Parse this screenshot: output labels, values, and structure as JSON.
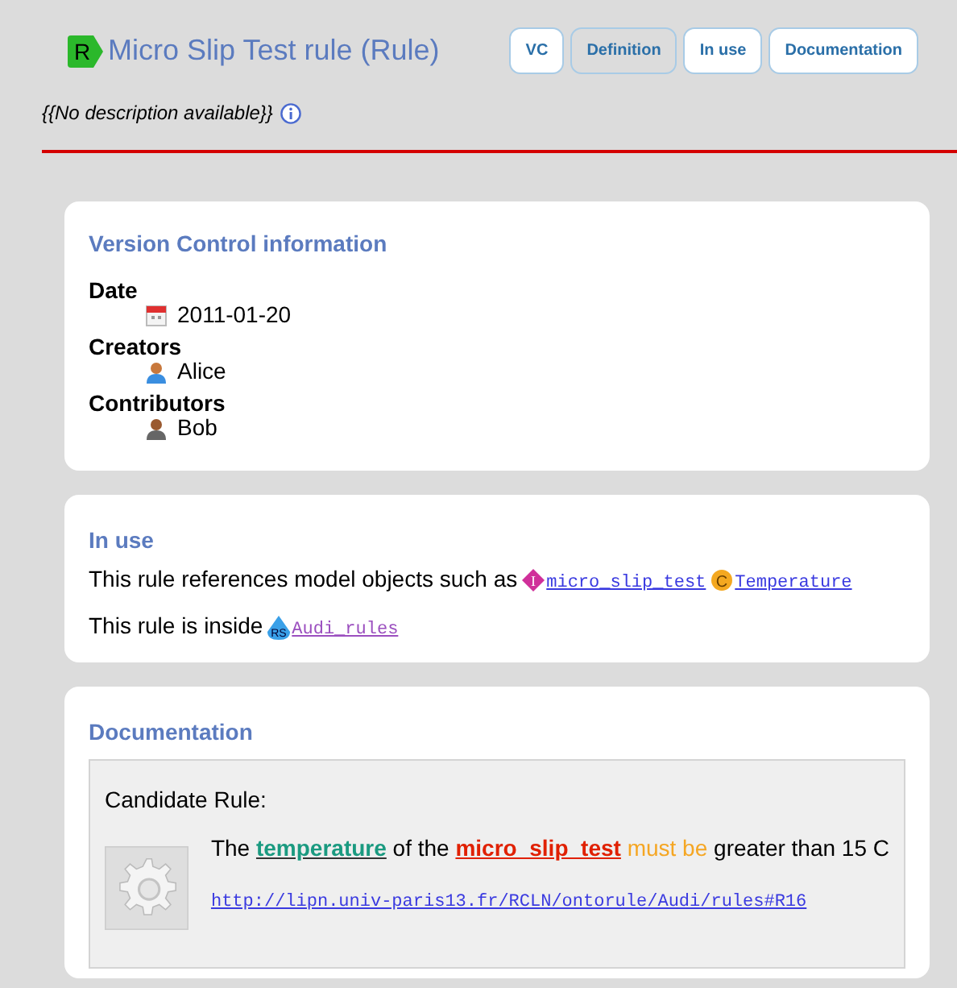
{
  "header": {
    "logo_letter": "R",
    "title": "Micro Slip Test rule (Rule)",
    "description": "{{No description available}}",
    "tabs": [
      {
        "label": "VC",
        "selected": false
      },
      {
        "label": "Definition",
        "selected": true
      },
      {
        "label": "In use",
        "selected": false
      },
      {
        "label": "Documentation",
        "selected": false
      }
    ]
  },
  "version_control": {
    "heading": "Version Control information",
    "groups": [
      {
        "heading": "Date",
        "kind": "date",
        "entries": [
          "2011-01-20"
        ]
      },
      {
        "heading": "Creators",
        "kind": "creator",
        "entries": [
          "Alice"
        ]
      },
      {
        "heading": "Contributors",
        "kind": "contributor",
        "entries": [
          "Bob"
        ]
      }
    ]
  },
  "in_use": {
    "heading": "In use",
    "references_text": "This rule references model objects such as",
    "references": [
      {
        "kind": "instance",
        "icon_letter": "I",
        "label": "micro_slip_test",
        "visited": false
      },
      {
        "kind": "concept",
        "icon_letter": "C",
        "label": "Temperature",
        "visited": false
      }
    ],
    "inside_text": "This rule is inside",
    "container": {
      "icon_letter": "RS",
      "label": "Audi_rules",
      "visited": true
    }
  },
  "documentation": {
    "heading": "Documentation",
    "candidate_label": "Candidate Rule:",
    "rule_parts": [
      {
        "kind": "plain",
        "text": "The"
      },
      {
        "kind": "concept",
        "text": "temperature"
      },
      {
        "kind": "plain",
        "text": "of the"
      },
      {
        "kind": "instance",
        "text": "micro_slip_test"
      },
      {
        "kind": "modal",
        "text": "must be"
      },
      {
        "kind": "plain",
        "text": "greater than 15 C"
      }
    ],
    "url": "http://lipn.univ-paris13.fr/RCLN/ontorule/Audi/rules#R16"
  }
}
